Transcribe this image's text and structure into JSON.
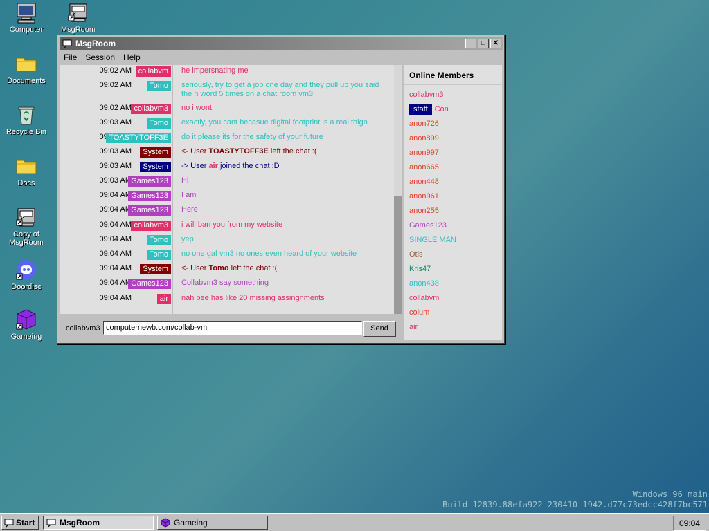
{
  "desktop": {
    "icons": [
      {
        "label": "Computer",
        "icon": "computer-icon"
      },
      {
        "label": "MsgRoom",
        "icon": "msgroom-icon"
      },
      {
        "label": "Documents",
        "icon": "folder-icon"
      },
      {
        "label": "Recycle Bin",
        "icon": "recycle-bin-icon"
      },
      {
        "label": "Docs",
        "icon": "folder-icon"
      },
      {
        "label": "Copy of MsgRoom",
        "icon": "msgroom-icon"
      },
      {
        "label": "Doordisc",
        "icon": "doordisc-icon"
      },
      {
        "label": "Gameing",
        "icon": "cube-icon"
      }
    ],
    "build_line1": "Windows 96 main",
    "build_line2": "Build 12839.88efa922 230410-1942.d77c73edcc428f7bc571"
  },
  "window": {
    "title": "MsgRoom",
    "menu": [
      "File",
      "Session",
      "Help"
    ],
    "messages": [
      {
        "time": "09:02 AM",
        "user": "collabvm",
        "color": "#e0306a",
        "text": "he impersnating me",
        "textcolor": "#e0306a"
      },
      {
        "time": "09:02 AM",
        "user": "Tomo",
        "color": "#2fbfbf",
        "text": "seriously, try to get a job one day and they pull up you said the n word 5 times on a chat room vm3",
        "textcolor": "#2fbfbf"
      },
      {
        "time": "09:02 AM",
        "user": "collabvm3",
        "color": "#e0306a",
        "text": "no i wont",
        "textcolor": "#e0306a"
      },
      {
        "time": "09:03 AM",
        "user": "Tomo",
        "color": "#2fbfbf",
        "text": "exactly, you cant becasue digital footprint is a real thign",
        "textcolor": "#2fbfbf"
      },
      {
        "time": "09:03 AM",
        "user": "TOASTYTOFF3E",
        "color": "#2fbfbf",
        "text": "do it please its for the safety of your future",
        "textcolor": "#2fbfbf"
      },
      {
        "time": "09:03 AM",
        "user": "System",
        "color": "#800000",
        "text_prefix": "<- User ",
        "text_user": "TOASTYTOFF3E",
        "text_suffix": " left the chat :(",
        "textcolor": "#800000"
      },
      {
        "time": "09:03 AM",
        "user": "System",
        "color": "#000080",
        "text_prefix": "-> User ",
        "text_user": "air",
        "text_suffix": " joined the chat :D",
        "textcolor": "#000080"
      },
      {
        "time": "09:03 AM",
        "user": "Games123",
        "color": "#b040c0",
        "text": "Hi",
        "textcolor": "#b040c0"
      },
      {
        "time": "09:04 AM",
        "user": "Games123",
        "color": "#b040c0",
        "text": "I am",
        "textcolor": "#b040c0"
      },
      {
        "time": "09:04 AM",
        "user": "Games123",
        "color": "#b040c0",
        "text": "Here",
        "textcolor": "#b040c0"
      },
      {
        "time": "09:04 AM",
        "user": "collabvm3",
        "color": "#e0306a",
        "text": "i will ban you from my website",
        "textcolor": "#e0306a"
      },
      {
        "time": "09:04 AM",
        "user": "Tomo",
        "color": "#2fbfbf",
        "text": "yep",
        "textcolor": "#2fbfbf"
      },
      {
        "time": "09:04 AM",
        "user": "Tomo",
        "color": "#2fbfbf",
        "text": "no one gaf vm3 no ones even heard of your website",
        "textcolor": "#2fbfbf"
      },
      {
        "time": "09:04 AM",
        "user": "System",
        "color": "#800000",
        "text_prefix": "<- User ",
        "text_user": "Tomo",
        "text_suffix": " left the chat :(",
        "textcolor": "#800000"
      },
      {
        "time": "09:04 AM",
        "user": "Games123",
        "color": "#b040c0",
        "text": "Collabvm3 say something",
        "textcolor": "#b040c0"
      },
      {
        "time": "09:04 AM",
        "user": "air",
        "color": "#e0306a",
        "text": "nah bee has like 20 missing assingnments",
        "textcolor": "#e0306a"
      }
    ],
    "members_title": "Online Members",
    "members": [
      {
        "name": "collabvm3",
        "color": "#e0306a"
      },
      {
        "staff": "staff",
        "name": "Con",
        "color": "#e0306a"
      },
      {
        "name": "anon726",
        "color": "#e04020"
      },
      {
        "name": "anon899",
        "color": "#e04020"
      },
      {
        "name": "anon997",
        "color": "#e04020"
      },
      {
        "name": "anon665",
        "color": "#e04020"
      },
      {
        "name": "anon448",
        "color": "#e04020"
      },
      {
        "name": "anon961",
        "color": "#e04020"
      },
      {
        "name": "anon255",
        "color": "#e04020"
      },
      {
        "name": "Games123",
        "color": "#b040c0"
      },
      {
        "name": "SINGLE MAN",
        "color": "#2fbfbf"
      },
      {
        "name": "Otis",
        "color": "#a06030"
      },
      {
        "name": "Kris47",
        "color": "#208060"
      },
      {
        "name": "anon438",
        "color": "#2fbfbf"
      },
      {
        "name": "collabvm",
        "color": "#e0306a"
      },
      {
        "name": "colum",
        "color": "#e04020"
      },
      {
        "name": "air",
        "color": "#e0306a"
      }
    ],
    "input_user": "collabvm3",
    "input_value": "computernewb.com/collab-vm",
    "send_label": "Send"
  },
  "taskbar": {
    "start_label": "Start",
    "items": [
      {
        "label": "MsgRoom",
        "active": true
      },
      {
        "label": "Gameing",
        "active": false
      }
    ],
    "clock": "09:04"
  }
}
